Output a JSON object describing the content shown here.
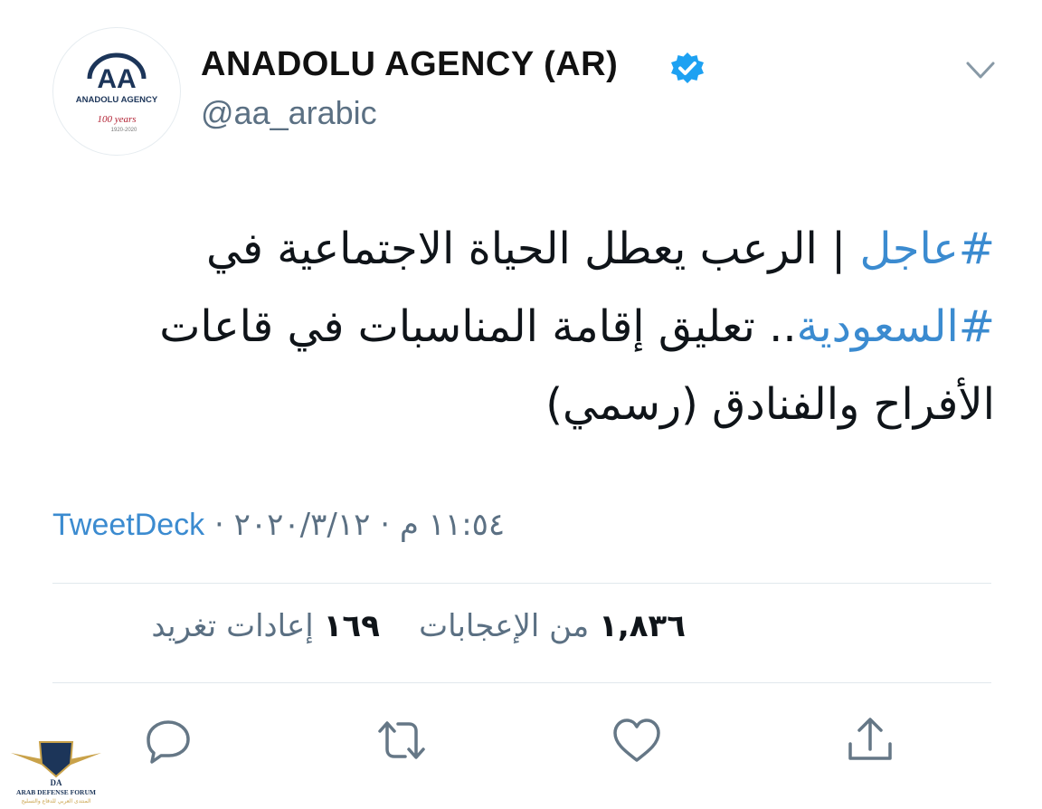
{
  "profile": {
    "display_name": "ANADOLU AGENCY (AR)",
    "handle": "@aa_arabic",
    "avatar_logo_text": "AA",
    "avatar_org_text": "ANADOLU AGENCY",
    "avatar_years_text": "100 years",
    "avatar_dates_text": "1920-2020"
  },
  "tweet": {
    "hashtag_1": "#عاجل",
    "text_1": " | الرعب يعطل الحياة الاجتماعية في ",
    "hashtag_2": "#السعودية",
    "text_2": ".. تعليق إقامة المناسبات في قاعات الأفراح والفنادق (رسمي)"
  },
  "meta": {
    "time": "١١:٥٤ م",
    "date": "٢٠٢٠/٣/١٢",
    "separator": "·",
    "source": "TweetDeck"
  },
  "stats": {
    "retweets_count": "١٦٩",
    "retweets_label": "إعادات تغريد",
    "likes_count": "١,٨٣٦",
    "likes_label": "من الإعجابات"
  },
  "actions": [
    "reply-icon",
    "retweet-icon",
    "like-icon",
    "share-icon"
  ],
  "watermark": {
    "logo_text": "DA",
    "title": "ARAB DEFENSE FORUM",
    "subtitle": "المنتدى العربي للدفاع والتسليح"
  },
  "colors": {
    "link": "#3b8bd0",
    "verified": "#1da1f2",
    "secondary_text": "#5b7083",
    "brand_navy": "#1c3559",
    "brand_red": "#b22234"
  }
}
